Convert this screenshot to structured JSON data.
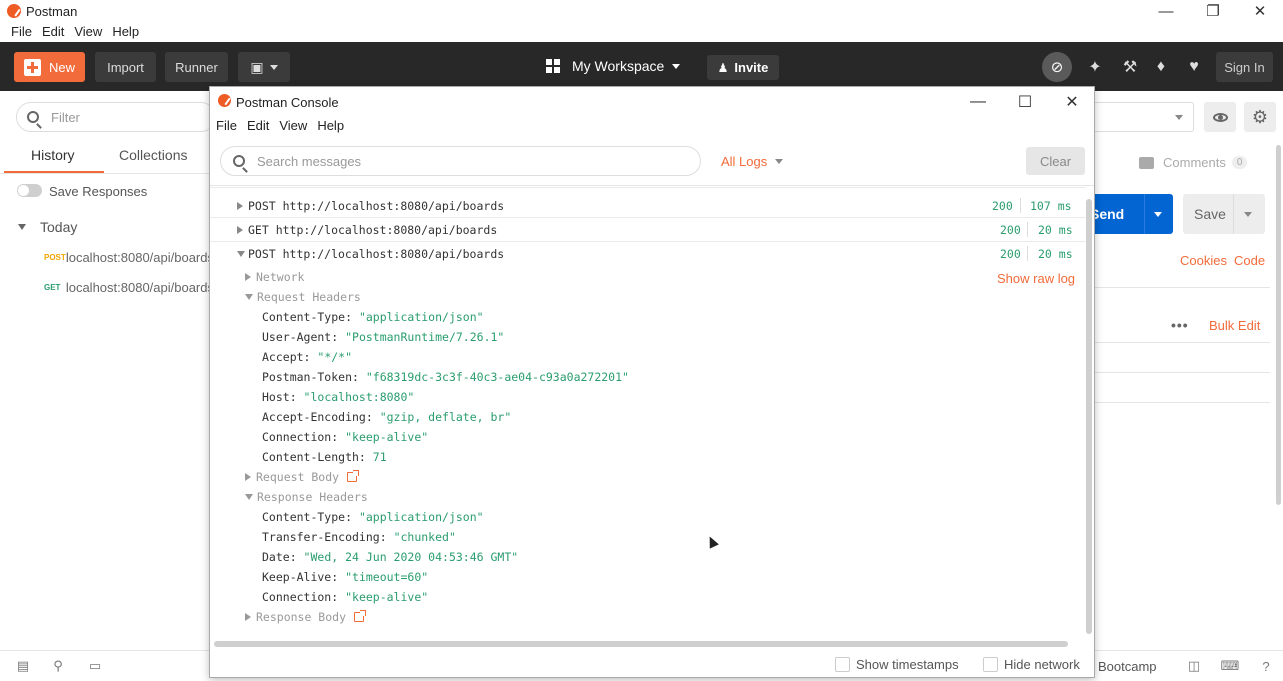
{
  "window": {
    "title": "Postman",
    "menu": [
      "File",
      "Edit",
      "View",
      "Help"
    ]
  },
  "toolbar": {
    "new_label": "New",
    "import_label": "Import",
    "runner_label": "Runner",
    "workspace_label": "My Workspace",
    "invite_label": "Invite",
    "signin_label": "Sign In"
  },
  "sidebar": {
    "filter_placeholder": "Filter",
    "tabs": [
      {
        "label": "History"
      },
      {
        "label": "Collections"
      }
    ],
    "save_responses_label": "Save Responses",
    "group_label": "Today",
    "items": [
      {
        "method": "POST",
        "method_color": "#f0a500",
        "url": "localhost:8080/api/boards"
      },
      {
        "method": "GET",
        "method_color": "#2a9d6e",
        "url": "localhost:8080/api/boards"
      }
    ]
  },
  "request_pane": {
    "comments_label": "Comments",
    "comments_count": "0",
    "send_label": "Send",
    "save_label": "Save",
    "cookies_label": "Cookies",
    "code_label": "Code",
    "bulk_edit_label": "Bulk Edit",
    "more_label": "•••"
  },
  "statusbar": {
    "bootcamp_label": "Bootcamp"
  },
  "console": {
    "title": "Postman Console",
    "menu": [
      "File",
      "Edit",
      "View",
      "Help"
    ],
    "search_placeholder": "Search messages",
    "filter_label": "All Logs",
    "clear_label": "Clear",
    "show_raw_log_label": "Show raw log",
    "entries": [
      {
        "text": "POST http://localhost:8080/api/boards",
        "status": "200",
        "time": "107 ms"
      },
      {
        "text": "GET http://localhost:8080/api/boards",
        "status": "200",
        "time": "20 ms"
      },
      {
        "text": "POST http://localhost:8080/api/boards",
        "status": "200",
        "time": "20 ms"
      }
    ],
    "sections": {
      "network": "Network",
      "request_headers": "Request Headers",
      "request_body": "Request Body",
      "response_headers": "Response Headers",
      "response_body": "Response Body"
    },
    "request_headers": [
      {
        "key": "Content-Type: ",
        "value": "\"application/json\""
      },
      {
        "key": "User-Agent: ",
        "value": "\"PostmanRuntime/7.26.1\""
      },
      {
        "key": "Accept: ",
        "value": "\"*/*\""
      },
      {
        "key": "Postman-Token: ",
        "value": "\"f68319dc-3c3f-40c3-ae04-c93a0a272201\""
      },
      {
        "key": "Host: ",
        "value": "\"localhost:8080\""
      },
      {
        "key": "Accept-Encoding: ",
        "value": "\"gzip, deflate, br\""
      },
      {
        "key": "Connection: ",
        "value": "\"keep-alive\""
      },
      {
        "key": "Content-Length: ",
        "value": "71"
      }
    ],
    "response_headers": [
      {
        "key": "Content-Type: ",
        "value": "\"application/json\""
      },
      {
        "key": "Transfer-Encoding: ",
        "value": "\"chunked\""
      },
      {
        "key": "Date: ",
        "value": "\"Wed, 24 Jun 2020 04:53:46 GMT\""
      },
      {
        "key": "Keep-Alive: ",
        "value": "\"timeout=60\""
      },
      {
        "key": "Connection: ",
        "value": "\"keep-alive\""
      }
    ],
    "show_timestamps_label": "Show timestamps",
    "hide_network_label": "Hide network"
  },
  "colors": {
    "accent": "#f26b3a",
    "send_blue": "#0265d2",
    "toolbar_bg": "#282828",
    "value_green": "#2a9d6e"
  }
}
